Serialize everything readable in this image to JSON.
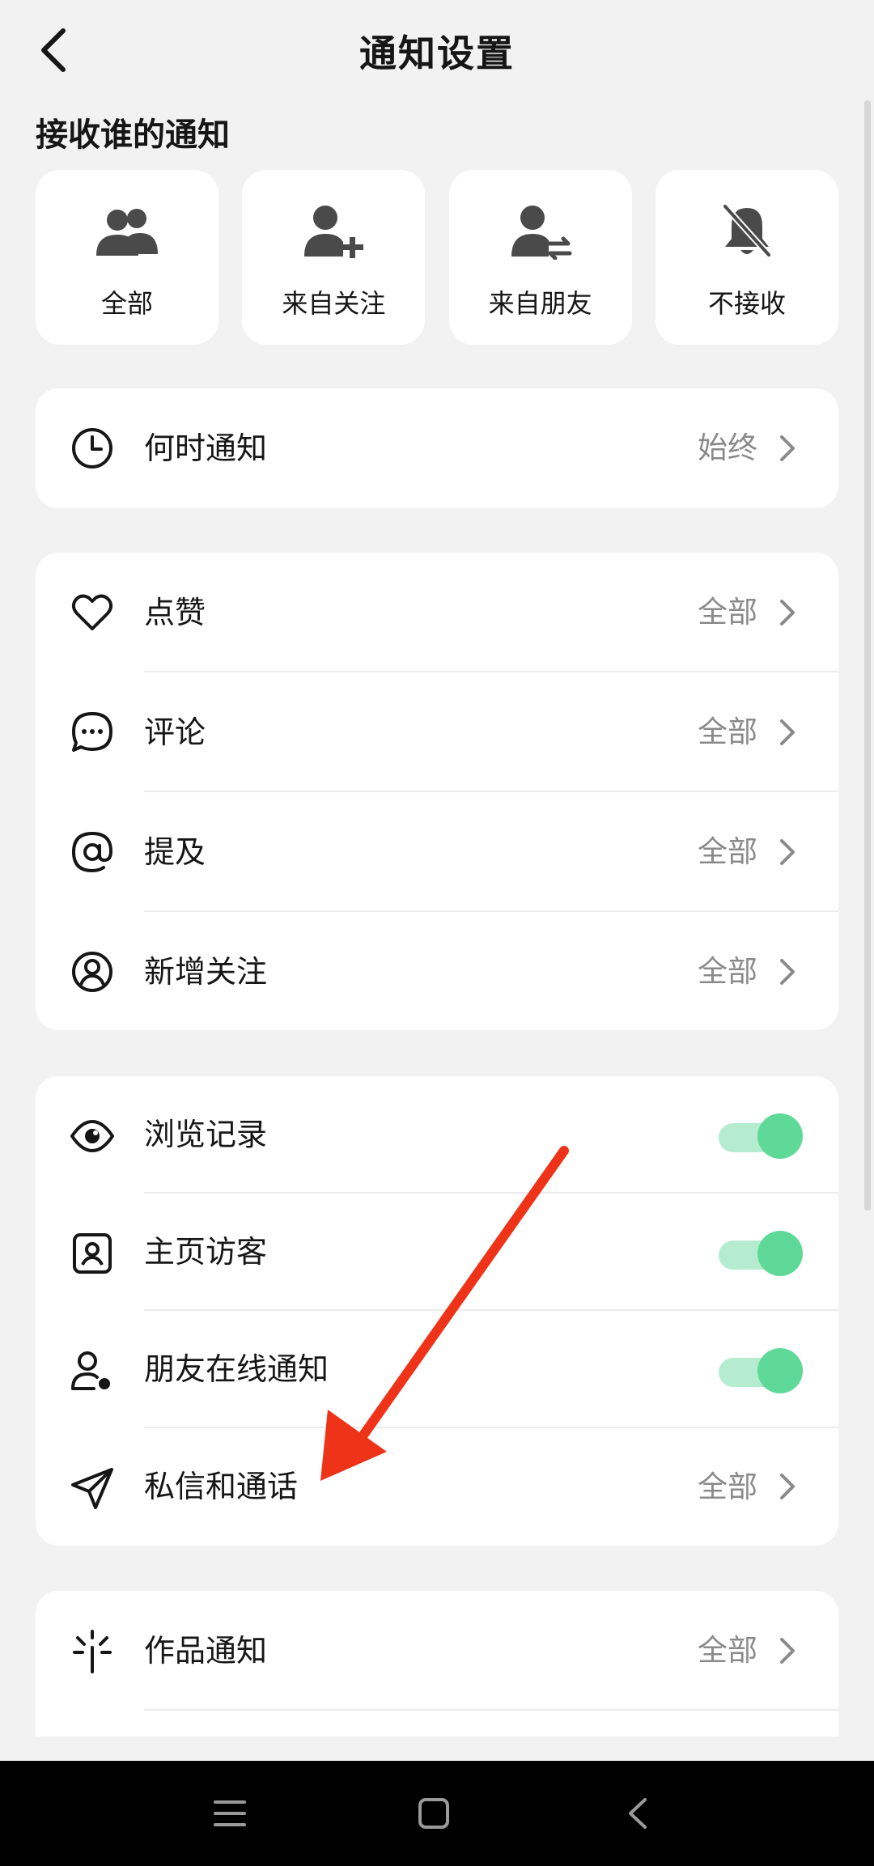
{
  "header": {
    "title": "通知设置",
    "back_icon": "chevron-left-icon"
  },
  "receive_from": {
    "title": "接收谁的通知",
    "options": [
      {
        "label": "全部",
        "icon": "group-users-icon"
      },
      {
        "label": "来自关注",
        "icon": "user-plus-icon"
      },
      {
        "label": "来自朋友",
        "icon": "user-exchange-icon"
      },
      {
        "label": "不接收",
        "icon": "bell-off-icon"
      }
    ]
  },
  "when": {
    "label": "何时通知",
    "value": "始终",
    "icon": "clock-icon"
  },
  "interactions": [
    {
      "label": "点赞",
      "value": "全部",
      "icon": "heart-icon"
    },
    {
      "label": "评论",
      "value": "全部",
      "icon": "comment-icon"
    },
    {
      "label": "提及",
      "value": "全部",
      "icon": "at-icon"
    },
    {
      "label": "新增关注",
      "value": "全部",
      "icon": "user-circle-icon"
    }
  ],
  "activity": [
    {
      "label": "浏览记录",
      "type": "toggle",
      "on": true,
      "icon": "eye-icon"
    },
    {
      "label": "主页访客",
      "type": "toggle",
      "on": true,
      "icon": "profile-card-icon"
    },
    {
      "label": "朋友在线通知",
      "type": "toggle",
      "on": true,
      "icon": "user-online-icon"
    },
    {
      "label": "私信和通话",
      "value": "全部",
      "icon": "send-icon"
    }
  ],
  "works": [
    {
      "label": "作品通知",
      "value": "全部",
      "icon": "sparkle-icon"
    }
  ],
  "colors": {
    "accent": "#5fd998",
    "toggle_track": "#b5ecd0",
    "annotation_arrow": "#ee3319",
    "background": "#f2f2f2"
  },
  "system_nav": {
    "icons": [
      "menu-icon",
      "home-square-icon",
      "back-triangle-icon"
    ]
  }
}
